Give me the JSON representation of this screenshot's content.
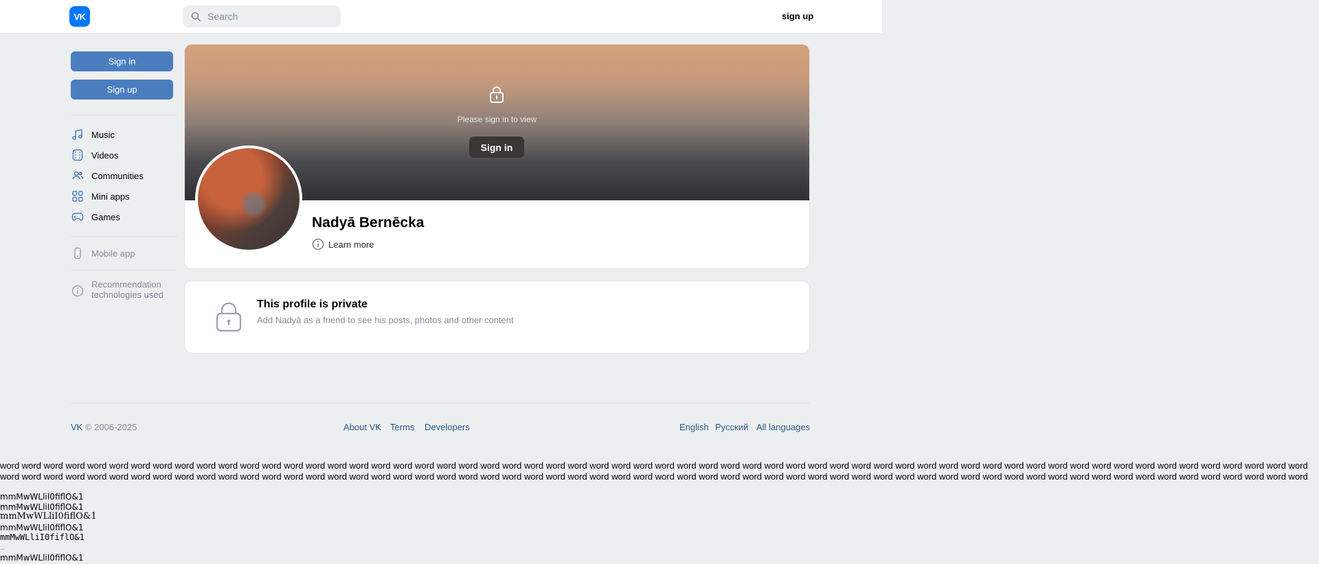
{
  "header": {
    "logo_text": "VK",
    "search_placeholder": "Search",
    "signup_label": "sign up"
  },
  "sidebar": {
    "sign_in": "Sign in",
    "sign_up": "Sign up",
    "items": [
      {
        "label": "Music",
        "icon": "music-note-icon"
      },
      {
        "label": "Videos",
        "icon": "video-film-icon"
      },
      {
        "label": "Communities",
        "icon": "users-icon"
      },
      {
        "label": "Mini apps",
        "icon": "grid-icon"
      },
      {
        "label": "Games",
        "icon": "gamepad-icon"
      }
    ],
    "mobile_app": "Mobile app",
    "recommendation": "Recommendation technologies used"
  },
  "profile": {
    "cover_text": "Please sign in to view",
    "cover_button": "Sign in",
    "name": "Nadyā Bernēcka",
    "learn_more": "Learn more"
  },
  "private": {
    "title": "This profile is private",
    "subtitle": "Add Nadyā as a friend to see his posts, photos and other content"
  },
  "footer": {
    "vk": "VK",
    "copyright": "© 2006-2025",
    "links_center": [
      "About VK",
      "Terms",
      "Developers"
    ],
    "languages": [
      "English",
      "Русский",
      "All languages"
    ]
  },
  "text_dump": {
    "word": "word",
    "repeats": 120,
    "mono_lines": [
      "mmMwWLliI0fiflO&1",
      "mmMwWLliI0fiflO&1",
      "mmMwWLliI0fiflO&1",
      "mmMwWLliI0fiflO&1",
      "mmMwWLliI0fiflO&1",
      "mmMwWLliI0fiflO&1"
    ]
  },
  "colors": {
    "accent": "#0077ff",
    "button_blue": "#4a7ebf",
    "link": "#2a5885",
    "muted": "#818c99"
  }
}
